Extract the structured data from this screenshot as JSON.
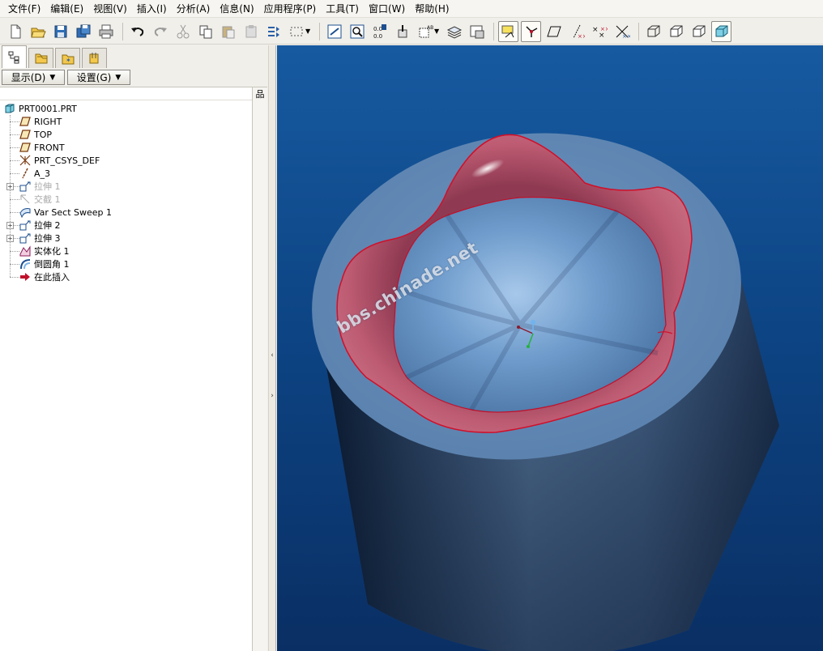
{
  "menu": [
    "文件(F)",
    "编辑(E)",
    "视图(V)",
    "插入(I)",
    "分析(A)",
    "信息(N)",
    "应用程序(P)",
    "工具(T)",
    "窗口(W)",
    "帮助(H)"
  ],
  "toolbar": {
    "buttons": [
      "new-icon",
      "open-icon",
      "save-icon",
      "save-copy-icon",
      "print-icon",
      "undo-icon",
      "redo-icon",
      "cut-icon",
      "copy-icon",
      "paste-icon",
      "paste-special-icon",
      "regenerate-icon",
      "select-box-icon",
      "repaint-icon",
      "zoom-fit-icon",
      "dimension-icon",
      "cursor-icon",
      "view-manager-icon",
      "layers-icon",
      "model-tree-icon",
      "datum-display-icon",
      "axis-display-icon",
      "plane-display-icon",
      "point-display-icon",
      "csys-display-icon",
      "spin-center-icon",
      "wireframe-icon",
      "hidden-line-icon",
      "no-hidden-icon",
      "shaded-icon"
    ],
    "active": [
      "datum-display-icon",
      "axis-display-icon",
      "shaded-icon"
    ]
  },
  "leftpanel": {
    "tabs": [
      "model-tree-tab-icon",
      "folder-browser-tab-icon",
      "favorites-tab-icon",
      "connections-tab-icon"
    ],
    "show_label": "显示(D)",
    "settings_label": "设置(G)",
    "tree_column_icon": "品"
  },
  "tree": {
    "root": "PRT0001.PRT",
    "items": [
      {
        "label": "RIGHT",
        "icon": "datum-plane-icon",
        "dim": false,
        "expandable": false
      },
      {
        "label": "TOP",
        "icon": "datum-plane-icon",
        "dim": false,
        "expandable": false
      },
      {
        "label": "FRONT",
        "icon": "datum-plane-icon",
        "dim": false,
        "expandable": false
      },
      {
        "label": "PRT_CSYS_DEF",
        "icon": "csys-icon",
        "dim": false,
        "expandable": false
      },
      {
        "label": "A_3",
        "icon": "datum-axis-icon",
        "dim": false,
        "expandable": false
      },
      {
        "label": "拉伸 1",
        "icon": "extrude-icon",
        "dim": true,
        "expandable": true
      },
      {
        "label": "交截 1",
        "icon": "intersect-icon",
        "dim": true,
        "expandable": false
      },
      {
        "label": "Var Sect Sweep 1",
        "icon": "var-sweep-icon",
        "dim": false,
        "expandable": false
      },
      {
        "label": "拉伸 2",
        "icon": "extrude-icon",
        "dim": false,
        "expandable": true
      },
      {
        "label": "拉伸 3",
        "icon": "extrude-icon",
        "dim": false,
        "expandable": true
      },
      {
        "label": "实体化 1",
        "icon": "solidify-icon",
        "dim": false,
        "expandable": false
      },
      {
        "label": "倒圆角 1",
        "icon": "round-icon",
        "dim": false,
        "expandable": false
      },
      {
        "label": "在此插入",
        "icon": "insert-here-arrow-icon",
        "dim": false,
        "expandable": false
      }
    ]
  },
  "viewport": {
    "watermark": "bbs.chinade.net",
    "colors": {
      "background_top": "#175aa0",
      "background_bottom": "#0a2f64",
      "body_face": "#5f86b3",
      "surface_red": "#b5536b",
      "edge_red": "#d0102a"
    }
  }
}
